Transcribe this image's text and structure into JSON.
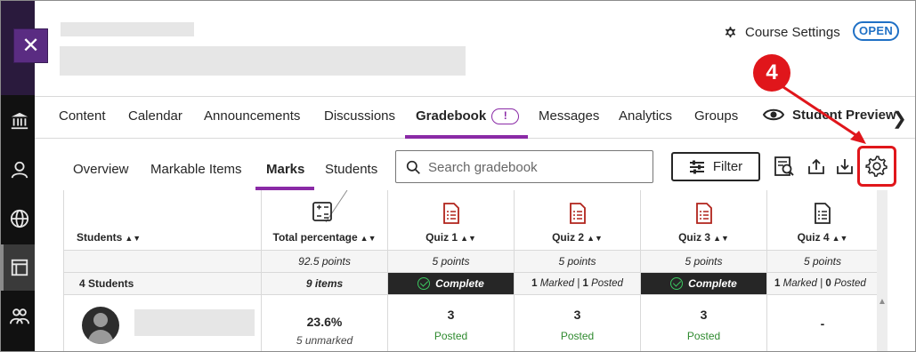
{
  "header": {
    "course_settings_label": "Course Settings",
    "status_badge": "OPEN"
  },
  "close_button": {
    "label": "✕"
  },
  "tabs": [
    {
      "label": "Content"
    },
    {
      "label": "Calendar"
    },
    {
      "label": "Announcements"
    },
    {
      "label": "Discussions"
    },
    {
      "label": "Gradebook",
      "badge": "!",
      "active": true
    },
    {
      "label": "Messages"
    },
    {
      "label": "Analytics"
    },
    {
      "label": "Groups"
    }
  ],
  "student_preview_label": "Student Preview",
  "subtabs": [
    {
      "label": "Overview"
    },
    {
      "label": "Markable Items"
    },
    {
      "label": "Marks",
      "active": true
    },
    {
      "label": "Students"
    }
  ],
  "search": {
    "placeholder": "Search gradebook",
    "value": ""
  },
  "toolbar": {
    "filter_label": "Filter",
    "icons": [
      "preview-search-icon",
      "upload-icon",
      "download-icon",
      "gear-icon"
    ]
  },
  "callout": {
    "number": "4",
    "color": "#e0161b"
  },
  "accent_color": "#8a2aa6",
  "link_color": "#1f70c5",
  "grid": {
    "students_header": "Students",
    "student_count": "4 Students",
    "columns": [
      {
        "title": "Total percentage",
        "points": "92.5 points",
        "summary": "9 items",
        "summary_type": "text"
      },
      {
        "title": "Quiz 1",
        "points": "5 points",
        "summary": "Complete",
        "summary_type": "complete"
      },
      {
        "title": "Quiz 2",
        "points": "5 points",
        "summary_marked": "1",
        "summary_marked_label": "Marked",
        "summary_posted": "1",
        "summary_posted_label": "Posted",
        "summary_type": "marked"
      },
      {
        "title": "Quiz 3",
        "points": "5 points",
        "summary": "Complete",
        "summary_type": "complete"
      },
      {
        "title": "Quiz 4",
        "points": "5 points",
        "summary_marked": "1",
        "summary_marked_label": "Marked",
        "summary_posted": "0",
        "summary_posted_label": "Posted",
        "summary_type": "marked"
      }
    ],
    "rows": [
      {
        "total": "23.6%",
        "total_note": "5 unmarked",
        "cells": [
          {
            "grade": "3",
            "status": "Posted"
          },
          {
            "grade": "3",
            "status": "Posted"
          },
          {
            "grade": "3",
            "status": "Posted"
          },
          {
            "grade": "-",
            "status": ""
          }
        ]
      }
    ]
  }
}
